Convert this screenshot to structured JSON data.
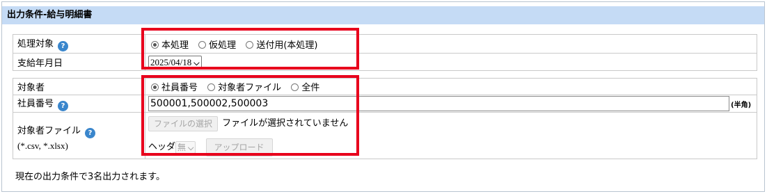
{
  "header": {
    "title": "出力条件-給与明細書"
  },
  "section1": {
    "processing_target": {
      "label": "処理対象",
      "options": [
        {
          "label": "本処理",
          "selected": true
        },
        {
          "label": "仮処理",
          "selected": false
        },
        {
          "label": "送付用(本処理)",
          "selected": false
        }
      ]
    },
    "payment_date": {
      "label": "支給年月日",
      "value": "2025/04/18"
    }
  },
  "section2": {
    "target": {
      "label": "対象者",
      "options": [
        {
          "label": "社員番号",
          "selected": true
        },
        {
          "label": "対象者ファイル",
          "selected": false
        },
        {
          "label": "全件",
          "selected": false
        }
      ]
    },
    "employee_number": {
      "label": "社員番号",
      "value": "500001,500002,500003",
      "suffix": "(半角)"
    },
    "target_file": {
      "label": "対象者ファイル",
      "sublabel": "(*.csv, *.xlsx)",
      "choose_button": "ファイルの選択",
      "no_file_text": "ファイルが選択されていません",
      "header_label": "ヘッダ",
      "header_value": "無",
      "upload_button": "アップロード"
    }
  },
  "footer": {
    "message": "現在の出力条件で3名出力されます。"
  },
  "icons": {
    "help": "question-circle-icon",
    "dropdown": "chevron-down-icon"
  },
  "colors": {
    "header_bg": "#c5dbf5",
    "highlight_border": "#e8001c",
    "help_icon": "#3a86cc"
  }
}
